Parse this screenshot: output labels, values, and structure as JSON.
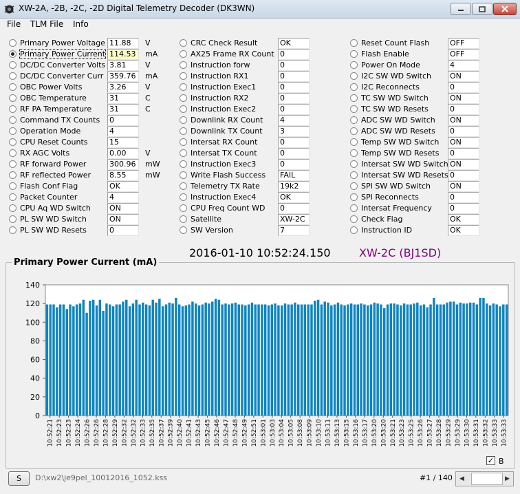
{
  "window": {
    "title": "XW-2A, -2B, -2C, -2D Digital Telemetry Decoder  (DK3WN)"
  },
  "menu": [
    "File",
    "TLM File",
    "Info"
  ],
  "col1": [
    {
      "label": "Primary Power Voltage",
      "value": "11.88",
      "unit": "V"
    },
    {
      "label": "Primary Power Current",
      "value": "114.53",
      "unit": "mA",
      "selected": true
    },
    {
      "label": "DC/DC Converter Volts",
      "value": "3.81",
      "unit": "V"
    },
    {
      "label": "DC/DC Converter Curr",
      "value": "359.76",
      "unit": "mA"
    },
    {
      "label": "OBC Power Volts",
      "value": "3.26",
      "unit": "V"
    },
    {
      "label": "OBC Temperature",
      "value": "31",
      "unit": "C"
    },
    {
      "label": "RF PA Temperature",
      "value": "31",
      "unit": "C"
    },
    {
      "label": "Command TX Counts",
      "value": "0",
      "unit": ""
    },
    {
      "label": "Operation Mode",
      "value": "4",
      "unit": ""
    },
    {
      "label": "CPU Reset Counts",
      "value": "15",
      "unit": ""
    },
    {
      "label": "RX AGC Volts",
      "value": "0.00",
      "unit": "V"
    },
    {
      "label": "RF forward Power",
      "value": "300.96",
      "unit": "mW"
    },
    {
      "label": "RF reflected Power",
      "value": "8.55",
      "unit": "mW"
    },
    {
      "label": "Flash Conf Flag",
      "value": "OK",
      "unit": ""
    },
    {
      "label": "Packet Counter",
      "value": "4",
      "unit": ""
    },
    {
      "label": "CPU Aq WD Switch",
      "value": "ON",
      "unit": ""
    },
    {
      "label": "PL SW WD Switch",
      "value": "ON",
      "unit": ""
    },
    {
      "label": "PL SW WD Resets",
      "value": "0",
      "unit": ""
    }
  ],
  "col2": [
    {
      "label": "CRC Check Result",
      "value": "OK"
    },
    {
      "label": "AX25 Frame RX Count",
      "value": "0"
    },
    {
      "label": "Instruction forw",
      "value": "0"
    },
    {
      "label": "Instruction RX1",
      "value": "0"
    },
    {
      "label": "Instruction Exec1",
      "value": "0"
    },
    {
      "label": "Instruction RX2",
      "value": "0"
    },
    {
      "label": "Instruction Exec2",
      "value": "0"
    },
    {
      "label": "Downlink RX Count",
      "value": "4"
    },
    {
      "label": "Downlink TX Count",
      "value": "3"
    },
    {
      "label": "Intersat RX Count",
      "value": "0"
    },
    {
      "label": "Intersat TX Count",
      "value": "0"
    },
    {
      "label": "Instruction Exec3",
      "value": "0"
    },
    {
      "label": "Write Flash Success",
      "value": "FAIL"
    },
    {
      "label": "Telemetry TX Rate",
      "value": "19k2"
    },
    {
      "label": "Instruction Exec4",
      "value": "OK"
    },
    {
      "label": "CPU Freq Count WD",
      "value": "0"
    },
    {
      "label": "Satellite",
      "value": "XW-2C"
    },
    {
      "label": "SW Version",
      "value": "7"
    }
  ],
  "col3": [
    {
      "label": "Reset Count Flash",
      "value": "OFF"
    },
    {
      "label": "Flash Enable",
      "value": "OFF"
    },
    {
      "label": "Power On Mode",
      "value": "4"
    },
    {
      "label": "I2C SW WD Switch",
      "value": "ON"
    },
    {
      "label": "I2C Reconnects",
      "value": "0"
    },
    {
      "label": "TC SW WD Switch",
      "value": "ON"
    },
    {
      "label": "TC SW WD Resets",
      "value": "0"
    },
    {
      "label": "ADC SW WD Switch",
      "value": "ON"
    },
    {
      "label": "ADC SW WD Resets",
      "value": "0"
    },
    {
      "label": "Temp SW WD Switch",
      "value": "ON"
    },
    {
      "label": "Temp SW WD Resets",
      "value": "0"
    },
    {
      "label": "Intersat SW WD Switch",
      "value": "ON"
    },
    {
      "label": "Intersat SW WD Resets",
      "value": "0"
    },
    {
      "label": "SPI SW WD Switch",
      "value": "ON"
    },
    {
      "label": "SPI Reconnects",
      "value": "0"
    },
    {
      "label": "Intersat Frequency",
      "value": "0"
    },
    {
      "label": "Check Flag",
      "value": "OK"
    },
    {
      "label": "Instruction ID",
      "value": "OK"
    }
  ],
  "status": {
    "timestamp": "2016-01-10 10:52:24.150",
    "satellite": "XW-2C (BJ1SD)"
  },
  "chart_data": {
    "type": "bar",
    "title": "Primary Power Current (mA)",
    "ylim": [
      0,
      140
    ],
    "yticks": [
      0,
      20,
      40,
      60,
      80,
      100,
      120,
      140
    ],
    "bar_color": "#0e84c2",
    "x_tick_labels": [
      "10:52:21",
      "10:52:23",
      "10:52:23",
      "10:52:24",
      "10:52:26",
      "10:52:26",
      "10:52:28",
      "10:52:29",
      "10:52:32",
      "10:52:32",
      "10:52:33",
      "10:52:35",
      "10:52:37",
      "10:52:39",
      "10:52:40",
      "10:52:41",
      "10:52:43",
      "10:52:45",
      "10:52:46",
      "10:52:47",
      "10:52:48",
      "10:52:49",
      "10:52:51",
      "10:53:01",
      "10:53:03",
      "10:53:04",
      "10:53:05",
      "10:53:08",
      "10:53:09",
      "10:53:10",
      "10:53:11",
      "10:53:13",
      "10:53:15",
      "10:53:16",
      "10:53:17",
      "10:53:20",
      "10:53:20",
      "10:53:21",
      "10:53:23",
      "10:53:25",
      "10:53:26",
      "10:53:27",
      "10:53:28",
      "10:53:29",
      "10:53:29",
      "10:53:30",
      "10:53:31",
      "10:53:32",
      "10:53:33",
      "10:53:33"
    ],
    "values": [
      119,
      119,
      119,
      116,
      119,
      119,
      114,
      119,
      117,
      119,
      120,
      124,
      110,
      123,
      124,
      118,
      124,
      112,
      120,
      119,
      117,
      119,
      119,
      122,
      124,
      117,
      120,
      124,
      119,
      121,
      119,
      118,
      124,
      121,
      125,
      117,
      119,
      121,
      120,
      126,
      119,
      117,
      118,
      119,
      122,
      120,
      118,
      119,
      121,
      120,
      122,
      125,
      124,
      119,
      120,
      119,
      120,
      121,
      119,
      119,
      118,
      119,
      121,
      119,
      119,
      119,
      119,
      118,
      119,
      120,
      118,
      118,
      120,
      119,
      119,
      121,
      119,
      119,
      119,
      119,
      119,
      123,
      124,
      119,
      122,
      121,
      118,
      119,
      121,
      119,
      118,
      119,
      120,
      119,
      119,
      120,
      119,
      118,
      119,
      121,
      120,
      119,
      115,
      119,
      120,
      120,
      119,
      118,
      120,
      119,
      119,
      120,
      121,
      118,
      119,
      116,
      119,
      126,
      119,
      119,
      119,
      121,
      122,
      122,
      119,
      121,
      120,
      120,
      121,
      121,
      119,
      126,
      126,
      120,
      118,
      120,
      119,
      117,
      119,
      119
    ],
    "legend_checkbox": "B"
  },
  "footer": {
    "s_button": "S",
    "file_path": "D:\\xw2\\je9pel_10012016_1052.kss",
    "record": "#1 / 140"
  }
}
